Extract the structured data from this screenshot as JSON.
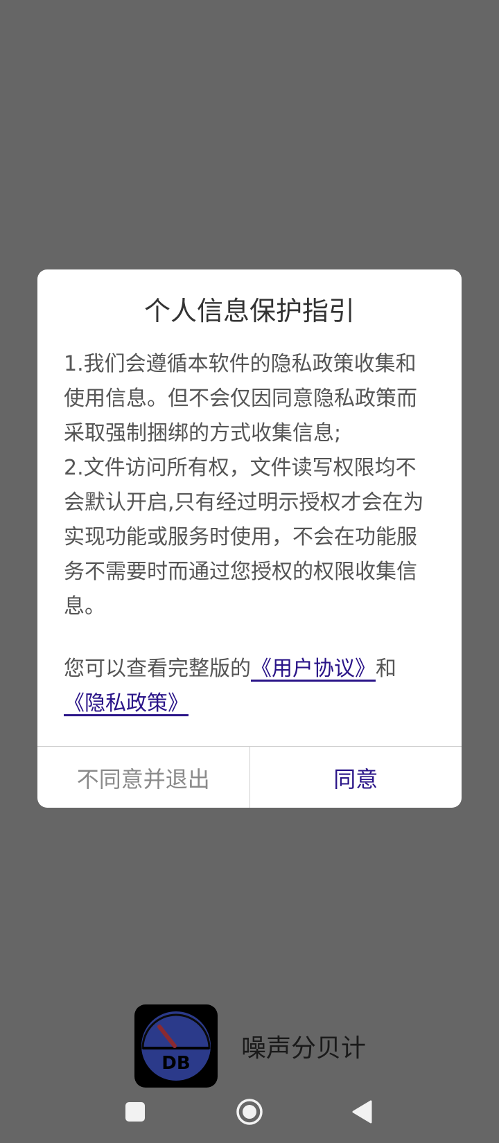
{
  "dialog": {
    "title": "个人信息保护指引",
    "paragraph1": "1.我们会遵循本软件的隐私政策收集和使用信息。但不会仅因同意隐私政策而采取强制捆绑的方式收集信息;",
    "paragraph2": "2.文件访问所有权，文件读写权限均不会默认开启,只有经过明示授权才会在为实现功能或服务时使用，不会在功能服务不需要时而通过您授权的权限收集信息。",
    "notice_prefix": "您可以查看完整版的",
    "user_agreement_link": "《用户协议》",
    "notice_and": "和",
    "privacy_policy_link": "《隐私政策》",
    "disagree_button": "不同意并退出",
    "agree_button": "同意"
  },
  "app": {
    "name": "噪声分贝计",
    "icon_text": "DB",
    "icon": "decibel-meter-icon"
  },
  "nav": {
    "recents_icon": "square-icon",
    "home_icon": "circle-icon",
    "back_icon": "triangle-back-icon"
  },
  "colors": {
    "background": "#666666",
    "dialog": "#ffffff",
    "accent": "#2a1488",
    "muted": "#8a8a8a",
    "icon_blue": "#2b3a8a",
    "needle": "#8a2a32"
  }
}
